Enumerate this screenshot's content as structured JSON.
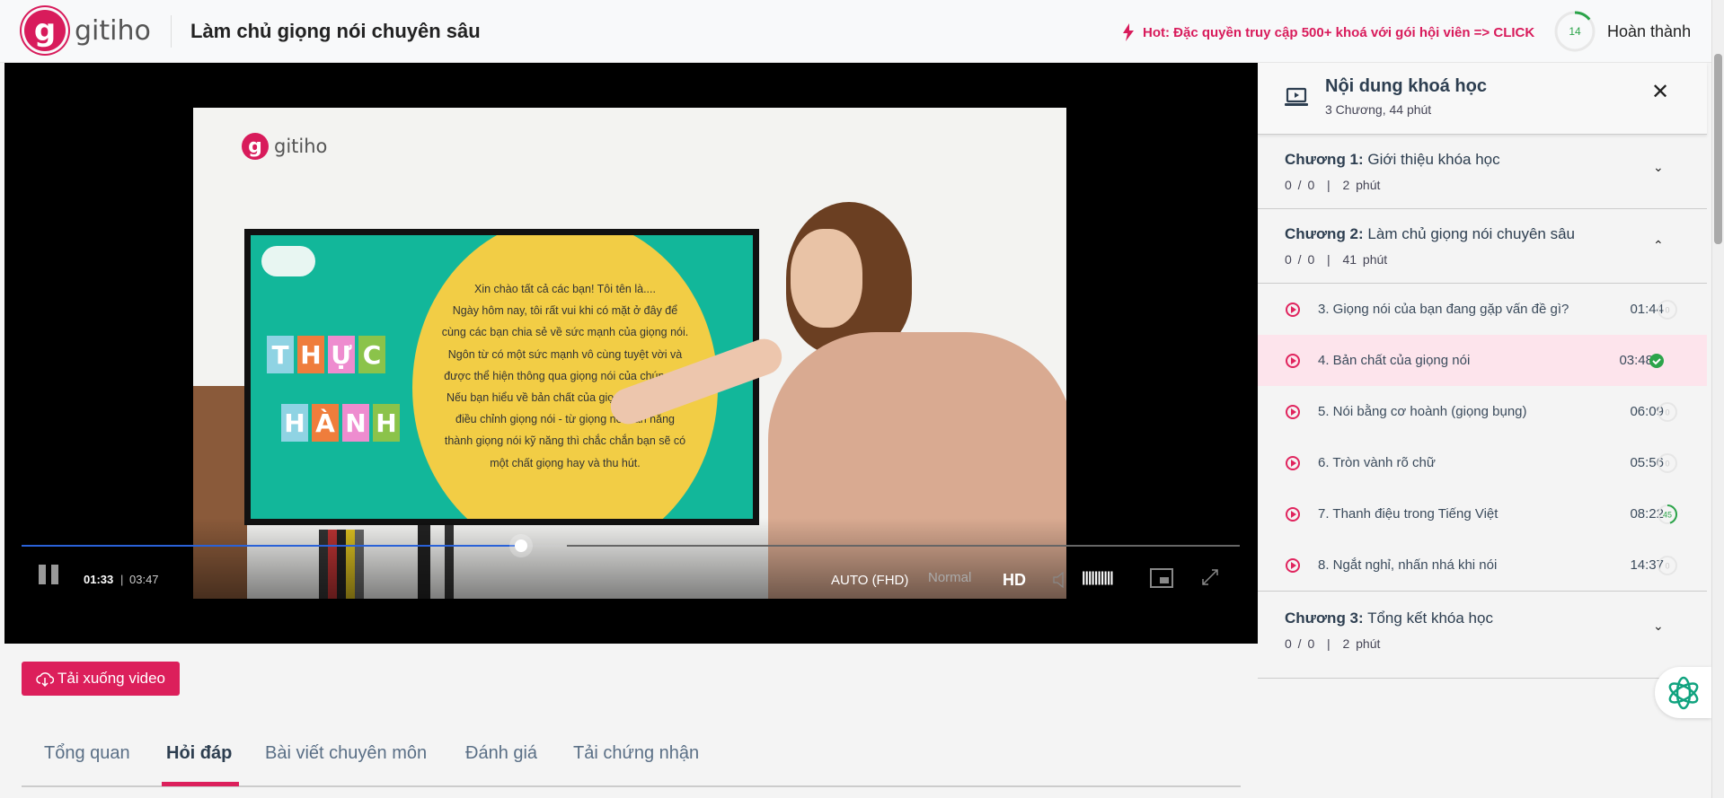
{
  "header": {
    "logo": "gitiho",
    "title": "Làm chủ giọng nói chuyên sâu",
    "promo": "Hot: Đặc quyền truy cập 500+ khoá với gói hội viên => CLICK",
    "progress_percent": 14,
    "progress_label": "14",
    "complete_label": "Hoàn thành"
  },
  "video": {
    "slide": {
      "logo": "gitiho",
      "word1": [
        "T",
        "H",
        "Ự",
        "C"
      ],
      "word2": [
        "H",
        "À",
        "N",
        "H"
      ],
      "lines": [
        "Xin chào tất cả các bạn! Tôi tên là....",
        "Ngày hôm nay, tôi rất vui khi có mặt ở đây để",
        "cùng các bạn chia sẻ về sức mạnh của giọng nói.",
        "Ngôn từ có một sức mạnh vô cùng tuyệt vời và",
        "được thể hiện thông qua giọng nói của chúng ta.",
        "Nếu bạn hiểu về bản chất của giọng và kỹ thuật",
        "điều chỉnh giọng nói - từ giọng nói bản năng",
        "thành giọng nói kỹ năng thì chắc chắn bạn sẽ có",
        "một chất giọng hay và thu hút."
      ]
    },
    "current_time": "01:33",
    "separator": "|",
    "duration": "03:47",
    "played_fraction": 0.41,
    "buffered_fraction": 0.448,
    "quality": "AUTO (FHD)",
    "speed": "Normal",
    "hd": "HD",
    "volume_bars": "||||||||||"
  },
  "download_label": "Tải xuống video",
  "tabs": [
    "Tổng quan",
    "Hỏi đáp",
    "Bài viết chuyên môn",
    "Đánh giá",
    "Tải chứng nhận"
  ],
  "active_tab": 1,
  "sidebar": {
    "title": "Nội dung khoá học",
    "subtitle": "3 Chương, 44 phút",
    "chapters": [
      {
        "label": "Chương 1:",
        "name": "Giới thiệu khóa học",
        "progress": "0 / 0",
        "sep": "|",
        "duration": "2 phút"
      },
      {
        "label": "Chương 2:",
        "name": "Làm chủ giọng nói chuyên sâu",
        "progress": "0 / 0",
        "sep": "|",
        "duration": "41 phút"
      },
      {
        "label": "Chương 3:",
        "name": "Tổng kết khóa học",
        "progress": "0 / 0",
        "sep": "|",
        "duration": "2 phút"
      }
    ],
    "lessons": [
      {
        "title": "3. Giọng nói của bạn đang gặp vấn đề gì?",
        "duration": "01:44",
        "status": "0"
      },
      {
        "title": "4. Bản chất của giọng nói",
        "duration": "03:48",
        "status": "done"
      },
      {
        "title": "5. Nói bằng cơ hoành (giọng bụng)",
        "duration": "06:09",
        "status": "0"
      },
      {
        "title": "6. Tròn vành rõ chữ",
        "duration": "05:56",
        "status": "0"
      },
      {
        "title": "7. Thanh điệu trong Tiếng Việt",
        "duration": "08:22",
        "status": "45"
      },
      {
        "title": "8. Ngắt nghỉ, nhấn nhá khi nói",
        "duration": "14:37",
        "status": "0"
      }
    ]
  },
  "colors": {
    "brand": "#dc1f5b",
    "success": "#2ca44a",
    "progress": "#2a62d8"
  }
}
